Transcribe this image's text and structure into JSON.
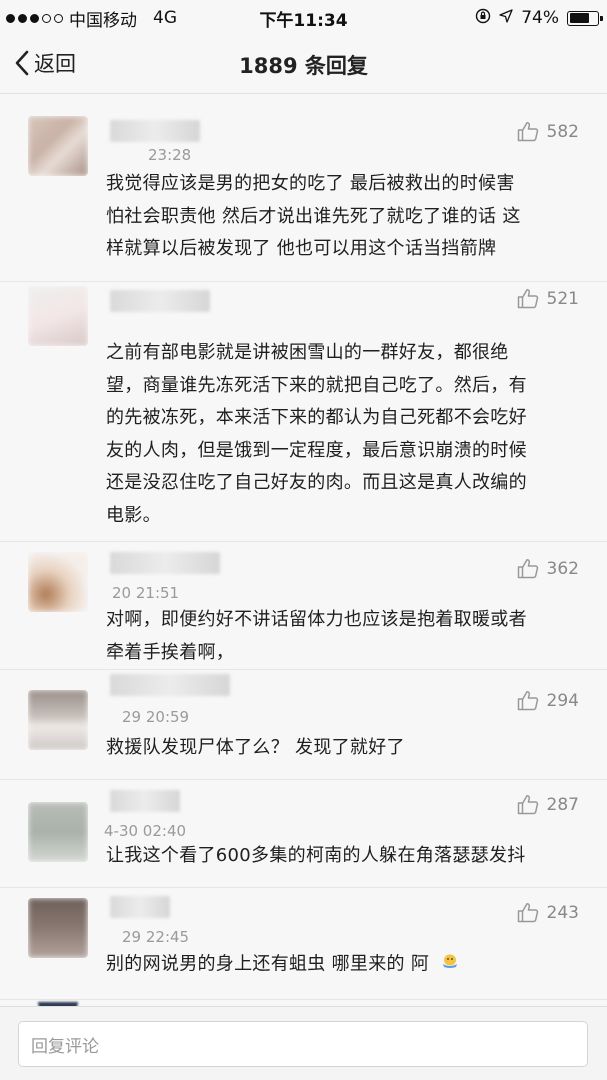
{
  "status": {
    "carrier": "中国移动",
    "network": "4G",
    "time": "下午11:34",
    "battery": "74%",
    "battery_level": 0.74
  },
  "nav": {
    "back_label": "返回",
    "title": "1889 条回复"
  },
  "comments": [
    {
      "time": "23:28",
      "likes": "582",
      "text_lines": [
        "我觉得应该是男的把女的吃了 最后被救出的时候害",
        "怕社会职责他 然后才说出谁先死了就吃了谁的话 这",
        "样就算以后被发现了 他也可以用这个话当挡箭牌"
      ]
    },
    {
      "time": "",
      "likes": "521",
      "text_lines": [
        "之前有部电影就是讲被困雪山的一群好友，都很绝",
        "望，商量谁先冻死活下来的就把自己吃了。然后，有",
        "的先被冻死，本来活下来的都认为自己死都不会吃好",
        "友的人肉，但是饿到一定程度，最后意识崩溃的时候",
        "还是没忍住吃了自己好友的肉。而且这是真人改编的",
        "电影。"
      ]
    },
    {
      "time": "20 21:51",
      "likes": "362",
      "text_lines": [
        "对啊，即便约好不讲话留体力也应该是抱着取暖或者",
        "牵着手挨着啊，"
      ]
    },
    {
      "time": "29 20:59",
      "likes": "294",
      "text_lines": [
        "救援队发现尸体了么？  发现了就好了"
      ]
    },
    {
      "time": "4-30 02:40",
      "likes": "287",
      "text_lines": [
        "让我这个看了600多集的柯南的人躲在角落瑟瑟发抖"
      ]
    },
    {
      "time": "29 22:45",
      "likes": "243",
      "text_lines": [
        "别的网说男的身上还有蛆虫 哪里来的 阿"
      ]
    }
  ],
  "reply": {
    "placeholder": "回复评论"
  },
  "colors": {
    "background": "#f7f7f7",
    "text": "#1f1f1f",
    "meta": "#9a9a9a"
  },
  "icons": [
    "back-chevron-icon",
    "thumbs-up-icon",
    "lock-rotation-icon",
    "location-arrow-icon",
    "battery-icon",
    "emoji-icon"
  ]
}
